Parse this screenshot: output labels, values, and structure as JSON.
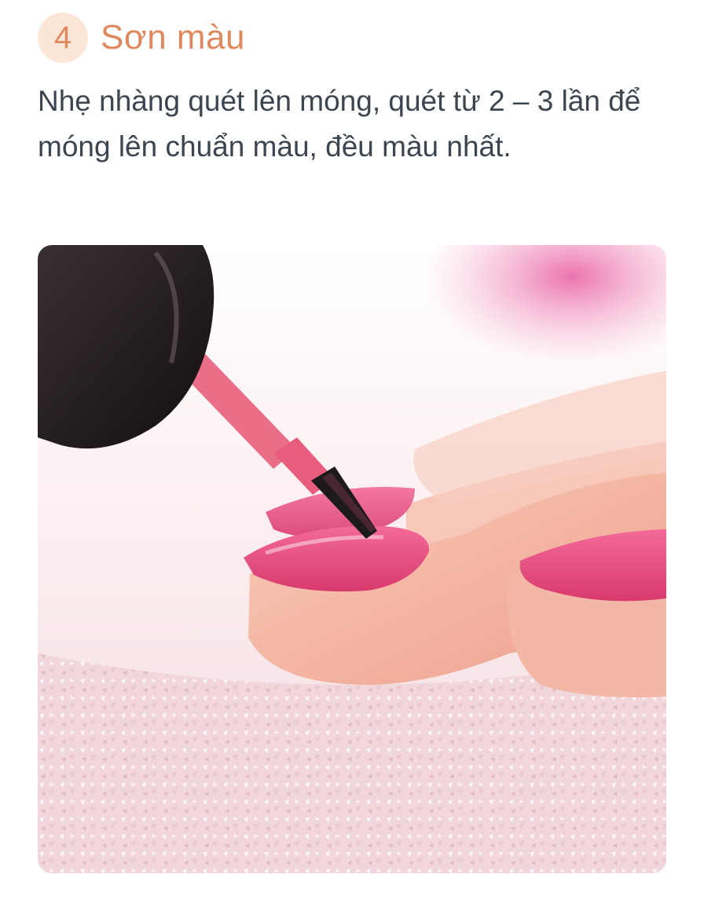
{
  "step": {
    "number": "4",
    "title": "Sơn màu",
    "description": "Nhẹ nhàng quét lên móng, quét từ 2 – 3 lần để móng lên chuẩn màu, đều màu nhất."
  },
  "colors": {
    "accent": "#e0895f",
    "badge_background": "#fce6d8",
    "body_text": "#3c4550",
    "nail_polish": "#e6457a"
  },
  "illustration": {
    "subject": "nail-polish-application-photo"
  }
}
